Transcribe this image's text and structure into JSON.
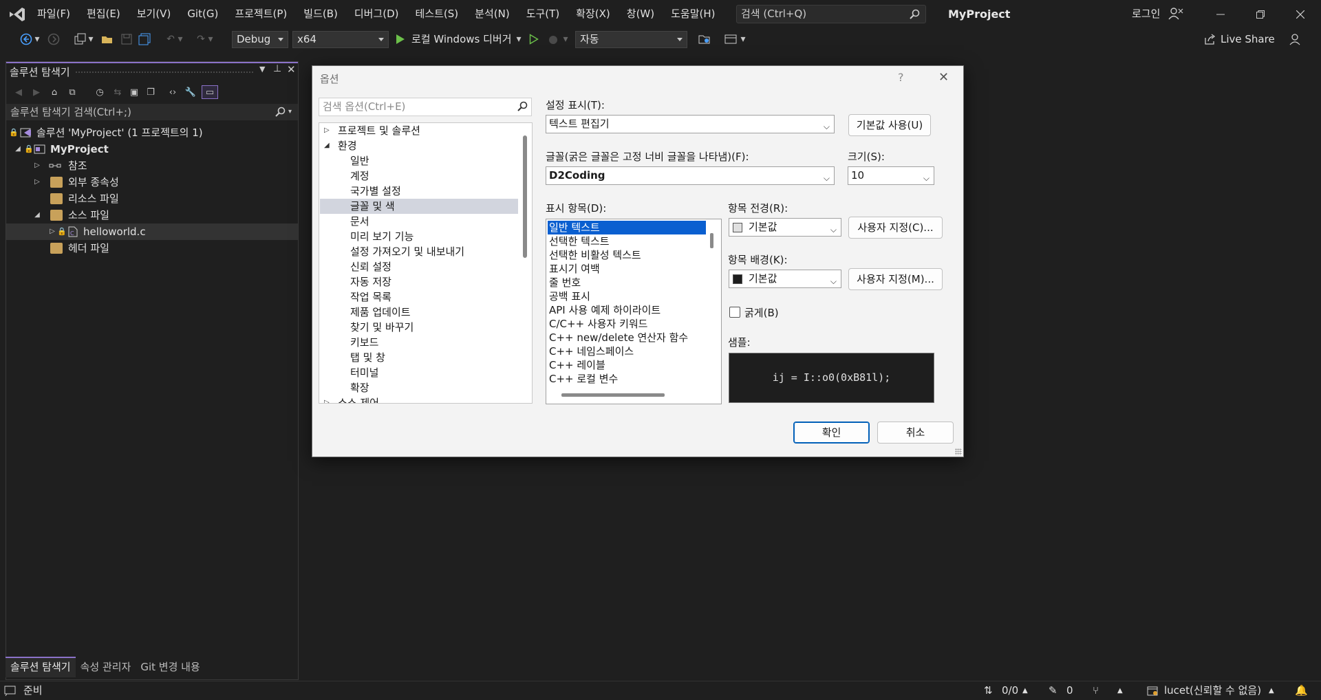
{
  "menubar": {
    "items": [
      "파일(F)",
      "편집(E)",
      "보기(V)",
      "Git(G)",
      "프로젝트(P)",
      "빌드(B)",
      "디버그(D)",
      "테스트(S)",
      "분석(N)",
      "도구(T)",
      "확장(X)",
      "창(W)",
      "도움말(H)"
    ],
    "search_label": "검색 (Ctrl+Q)",
    "project_name": "MyProject",
    "login_label": "로그인"
  },
  "toolbar": {
    "config": "Debug",
    "platform": "x64",
    "debugger_label": "로컬 Windows 디버거",
    "auto_combo": "자동",
    "live_share": "Live Share"
  },
  "solution_explorer": {
    "title": "솔루션 탐색기",
    "search_placeholder": "솔루션 탐색기 검색(Ctrl+;)",
    "solution_label": "솔루션 'MyProject' (1 프로젝트의 1)",
    "project_label": "MyProject",
    "references_label": "참조",
    "external_deps_label": "외부 종속성",
    "resource_files_label": "리소스 파일",
    "source_files_label": "소스 파일",
    "file_label": "helloworld.c",
    "header_files_label": "헤더 파일",
    "bottom_tabs": [
      "솔루션 탐색기",
      "속성 관리자",
      "Git 변경 내용"
    ]
  },
  "statusbar": {
    "ready": "준비",
    "line_count": "0/0",
    "pen_count": "0",
    "branch": "lucet(신뢰할 수 없음)"
  },
  "dialog": {
    "title": "옵션",
    "help": "?",
    "search_placeholder": "검색 옵션(Ctrl+E)",
    "tree": {
      "projects": "프로젝트 및 솔루션",
      "environment": "환경",
      "children": [
        "일반",
        "계정",
        "국가별 설정",
        "글꼴 및 색",
        "문서",
        "미리 보기 기능",
        "설정 가져오기 및 내보내기",
        "신뢰 설정",
        "자동 저장",
        "작업 목록",
        "제품 업데이트",
        "찾기 및 바꾸기",
        "키보드",
        "탭 및 창",
        "터미널",
        "확장"
      ],
      "partial_next": "소스 제어"
    },
    "show_settings_label": "설정 표시(T):",
    "show_settings_value": "텍스트 편집기",
    "use_defaults_button": "기본값 사용(U)",
    "font_label": "글꼴(굵은 글꼴은 고정 너비 글꼴을 나타냄)(F):",
    "font_value": "D2Coding",
    "size_label": "크기(S):",
    "size_value": "10",
    "display_items_label": "표시 항목(D):",
    "display_items": [
      "일반 텍스트",
      "선택한 텍스트",
      "선택한 비활성 텍스트",
      "표시기 여백",
      "줄 번호",
      "공백 표시",
      "API 사용 예제 하이라이트",
      "C/C++ 사용자 키워드",
      "C++ new/delete 연산자 함수",
      "C++ 네임스페이스",
      "C++ 레이블",
      "C++ 로컬 변수"
    ],
    "fg_label": "항목 전경(R):",
    "fg_value": "기본값",
    "fg_custom_button": "사용자 지정(C)...",
    "bg_label": "항목 배경(K):",
    "bg_value": "기본값",
    "bg_custom_button": "사용자 지정(M)...",
    "bold_label": "굵게(B)",
    "sample_label": "샘플:",
    "sample_text": "ij = I::o0(0xB81l);",
    "ok_button": "확인",
    "cancel_button": "취소"
  },
  "colors": {
    "accent": "#8b72c9",
    "selection": "#0a5fd0",
    "run_green": "#6cc04a"
  }
}
